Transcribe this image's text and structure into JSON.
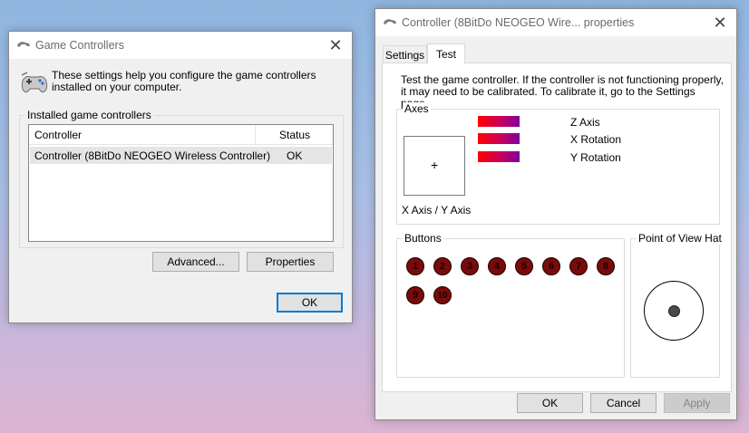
{
  "game_controllers": {
    "title": "Game Controllers",
    "description": "These settings help you configure the game controllers installed on your computer.",
    "group_label": "Installed game controllers",
    "columns": [
      "Controller",
      "Status"
    ],
    "rows": [
      {
        "controller": "Controller (8BitDo NEOGEO Wireless Controller)",
        "status": "OK"
      }
    ],
    "advanced_label": "Advanced...",
    "properties_label": "Properties",
    "ok_label": "OK"
  },
  "controller_properties": {
    "title": "Controller (8BitDo NEOGEO Wire... properties",
    "tabs": [
      "Settings",
      "Test"
    ],
    "active_tab": "Test",
    "instructions": "Test the game controller.  If the controller is not functioning properly, it may need to be calibrated.  To calibrate it, go to the Settings page.",
    "axes_label": "Axes",
    "axes": [
      "Z Axis",
      "X Rotation",
      "Y Rotation"
    ],
    "xy_label": "X Axis / Y Axis",
    "buttons_label": "Buttons",
    "buttons": [
      "1",
      "2",
      "3",
      "4",
      "5",
      "6",
      "7",
      "8",
      "9",
      "10"
    ],
    "pov_label": "Point of View Hat",
    "ok_label": "OK",
    "cancel_label": "Cancel",
    "apply_label": "Apply"
  },
  "icons": {
    "window_icon": "gamepad-icon",
    "close": "close-icon"
  },
  "colors": {
    "axis_bar_start": "#ff0000",
    "axis_bar_end": "#8000a0",
    "button_fill": "#7a0b0b"
  }
}
